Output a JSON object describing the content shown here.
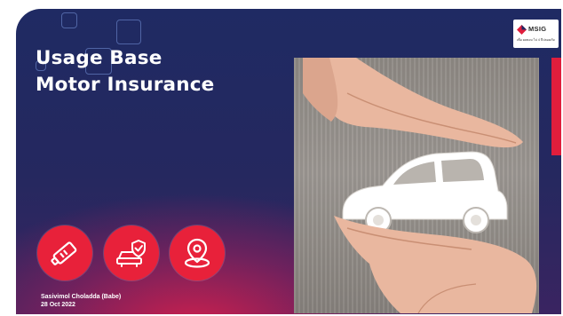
{
  "slide": {
    "title_line1": "Usage Base",
    "title_line2": "Motor Insurance",
    "presenter_name": "Sasivimol Choladda (Babe)",
    "presenter_date": "28 Oct 2022"
  },
  "logo": {
    "brand": "MSIG",
    "tagline": "เพื่อ ผลตอบ ไป 4 ปีปลอดภัย"
  },
  "icons": [
    "car-key-icon",
    "car-shield-icon",
    "location-pin-icon"
  ],
  "colors": {
    "slide_bg": "#1f2a63",
    "accent_red": "#e8213a",
    "photo_wood": "#9a958f"
  }
}
